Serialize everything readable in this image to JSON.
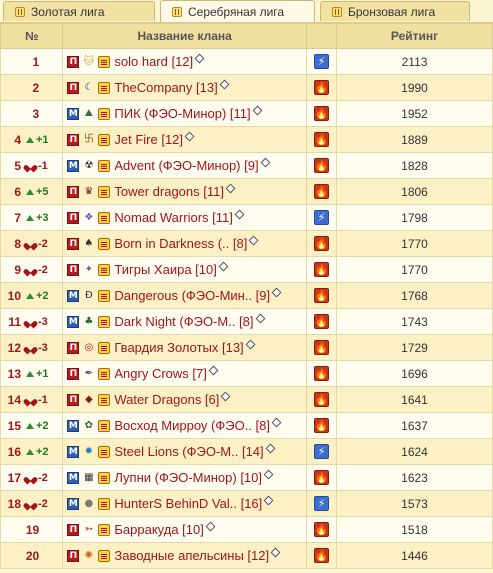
{
  "tabs": [
    {
      "label": "Золотая лига",
      "active": false
    },
    {
      "label": "Серебряная лига",
      "active": true
    },
    {
      "label": "Бронзовая лига",
      "active": false
    }
  ],
  "table": {
    "headers": {
      "rank": "№",
      "name": "Название клана",
      "rating": "Рейтинг"
    },
    "rows": [
      {
        "rank": "1",
        "change": "",
        "dir": "none",
        "name": "solo hard [12]",
        "rating": "2113",
        "side": "П",
        "element": "lightning",
        "emblem": "🐱",
        "embColor": "#d9a94e"
      },
      {
        "rank": "2",
        "change": "",
        "dir": "none",
        "name": "TheCompany [13]",
        "rating": "1990",
        "side": "П",
        "element": "fire",
        "emblem": "☾",
        "embColor": "#2a3d8f"
      },
      {
        "rank": "3",
        "change": "",
        "dir": "none",
        "name": "ПИК (ФЭО-Минор) [11]",
        "rating": "1952",
        "side": "М",
        "element": "fire",
        "emblem": "⛰",
        "embColor": "#3b6e3b"
      },
      {
        "rank": "4",
        "change": "+1",
        "dir": "up",
        "name": "Jet Fire [12]",
        "rating": "1889",
        "side": "П",
        "element": "fire",
        "emblem": "卐",
        "embColor": "#8a5a00"
      },
      {
        "rank": "5",
        "change": "-1",
        "dir": "down",
        "name": "Advent (ФЭО-Минор) [9]",
        "rating": "1828",
        "side": "М",
        "element": "fire",
        "emblem": "☢",
        "embColor": "#2b2b2b"
      },
      {
        "rank": "6",
        "change": "+5",
        "dir": "up",
        "name": "Tower dragons [11]",
        "rating": "1806",
        "side": "П",
        "element": "fire",
        "emblem": "♛",
        "embColor": "#7a1010"
      },
      {
        "rank": "7",
        "change": "+3",
        "dir": "up",
        "name": "Nomad Warriors [11]",
        "rating": "1798",
        "side": "П",
        "element": "lightning",
        "emblem": "❖",
        "embColor": "#6a4fb0"
      },
      {
        "rank": "8",
        "change": "-2",
        "dir": "down",
        "name": "Born in Darkness (.. [8]",
        "rating": "1770",
        "side": "П",
        "element": "fire",
        "emblem": "♠",
        "embColor": "#333333"
      },
      {
        "rank": "9",
        "change": "-2",
        "dir": "down",
        "name": "Тигры Хаира [10]",
        "rating": "1770",
        "side": "П",
        "element": "fire",
        "emblem": "✦",
        "embColor": "#6a6a8a"
      },
      {
        "rank": "10",
        "change": "+2",
        "dir": "up",
        "name": "Dangerous (ФЭО-Мин.. [9]",
        "rating": "1768",
        "side": "М",
        "element": "fire",
        "emblem": "Ð",
        "embColor": "#1f2a6a"
      },
      {
        "rank": "11",
        "change": "-3",
        "dir": "down",
        "name": "Dark Night (ФЭО-М.. [8]",
        "rating": "1743",
        "side": "М",
        "element": "fire",
        "emblem": "♣",
        "embColor": "#2e6a2e"
      },
      {
        "rank": "12",
        "change": "-3",
        "dir": "down",
        "name": "Гвардия Золотых  [13]",
        "rating": "1729",
        "side": "П",
        "element": "fire",
        "emblem": "◎",
        "embColor": "#a0161d"
      },
      {
        "rank": "13",
        "change": "+1",
        "dir": "up",
        "name": "Angry Crows [7]",
        "rating": "1696",
        "side": "П",
        "element": "fire",
        "emblem": "✒",
        "embColor": "#2a4fa0"
      },
      {
        "rank": "14",
        "change": "-1",
        "dir": "down",
        "name": "Water Dragons [6]",
        "rating": "1641",
        "side": "П",
        "element": "fire",
        "emblem": "◆",
        "embColor": "#8a1e08"
      },
      {
        "rank": "15",
        "change": "+2",
        "dir": "up",
        "name": "Восход Мирроу (ФЭО.. [8]",
        "rating": "1637",
        "side": "М",
        "element": "fire",
        "emblem": "✿",
        "embColor": "#2e6a2e"
      },
      {
        "rank": "16",
        "change": "+2",
        "dir": "up",
        "name": "Steel Lions (ФЭО-М.. [14]",
        "rating": "1624",
        "side": "М",
        "element": "lightning",
        "emblem": "✹",
        "embColor": "#2a7ac0"
      },
      {
        "rank": "17",
        "change": "-2",
        "dir": "down",
        "name": "Лупни (ФЭО-Минор) [10]",
        "rating": "1623",
        "side": "М",
        "element": "fire",
        "emblem": "▦",
        "embColor": "#333333"
      },
      {
        "rank": "18",
        "change": "-2",
        "dir": "down",
        "name": "HunterS BehinD Val.. [16]",
        "rating": "1573",
        "side": "М",
        "element": "lightning",
        "emblem": "●",
        "embColor": "#7a7a7a"
      },
      {
        "rank": "19",
        "change": "",
        "dir": "none",
        "name": "Барракуда [10]",
        "rating": "1518",
        "side": "П",
        "element": "fire",
        "emblem": "➳",
        "embColor": "#a0161d"
      },
      {
        "rank": "20",
        "change": "",
        "dir": "none",
        "name": "Заводные апельсины [12]",
        "rating": "1446",
        "side": "П",
        "element": "fire",
        "emblem": "✺",
        "embColor": "#c46a10"
      }
    ]
  },
  "colors": {
    "clanName": "#a0161d",
    "rankUp": "#1f7a1f",
    "rankDown": "#a0161d",
    "rowOdd": "#fffdf0",
    "rowEven": "#fbf1c4",
    "header": "#f0e0a0"
  },
  "icons": {
    "side_p": "red-side-badge-icon",
    "side_m": "blue-side-badge-icon",
    "rank": "clan-rank-icon",
    "info": "clan-info-icon",
    "lightning": "lightning-element-icon",
    "fire": "fire-element-icon"
  }
}
